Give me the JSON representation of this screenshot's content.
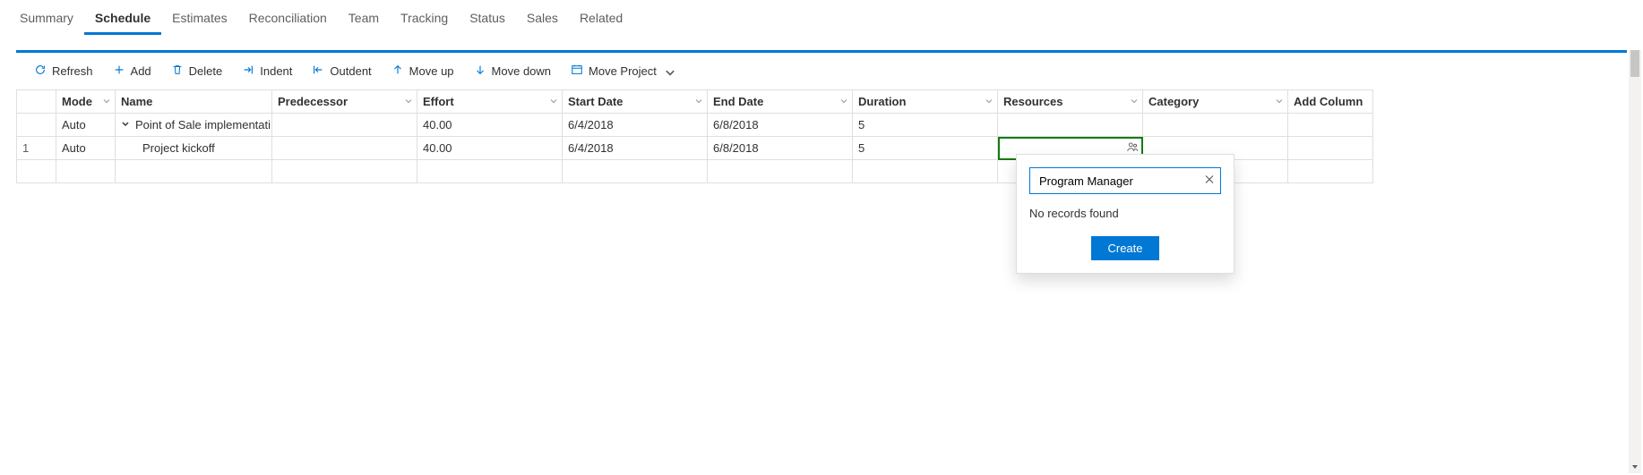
{
  "tabs": {
    "items": [
      {
        "label": "Summary"
      },
      {
        "label": "Schedule",
        "active": true
      },
      {
        "label": "Estimates"
      },
      {
        "label": "Reconciliation"
      },
      {
        "label": "Team"
      },
      {
        "label": "Tracking"
      },
      {
        "label": "Status"
      },
      {
        "label": "Sales"
      },
      {
        "label": "Related"
      }
    ]
  },
  "toolbar": {
    "refresh": "Refresh",
    "add": "Add",
    "delete": "Delete",
    "indent": "Indent",
    "outdent": "Outdent",
    "moveup": "Move up",
    "movedown": "Move down",
    "moveproject": "Move Project"
  },
  "columns": {
    "rownum": "",
    "mode": "Mode",
    "name": "Name",
    "predecessor": "Predecessor",
    "effort": "Effort",
    "startdate": "Start Date",
    "enddate": "End Date",
    "duration": "Duration",
    "resources": "Resources",
    "category": "Category",
    "addcolumn": "Add Column"
  },
  "rows": [
    {
      "rownum": "",
      "mode": "Auto",
      "name": "Point of Sale implementati",
      "predecessor": "",
      "effort": "40.00",
      "startdate": "6/4/2018",
      "enddate": "6/8/2018",
      "duration": "5",
      "resources": "",
      "category": "",
      "expandable": true
    },
    {
      "rownum": "1",
      "mode": "Auto",
      "name": "Project kickoff",
      "predecessor": "",
      "effort": "40.00",
      "startdate": "6/4/2018",
      "enddate": "6/8/2018",
      "duration": "5",
      "resources": "",
      "category": "",
      "indent": 1,
      "selected_resource_cell": true
    }
  ],
  "lookup": {
    "search_value": "Program Manager",
    "no_records": "No records found",
    "create": "Create"
  }
}
